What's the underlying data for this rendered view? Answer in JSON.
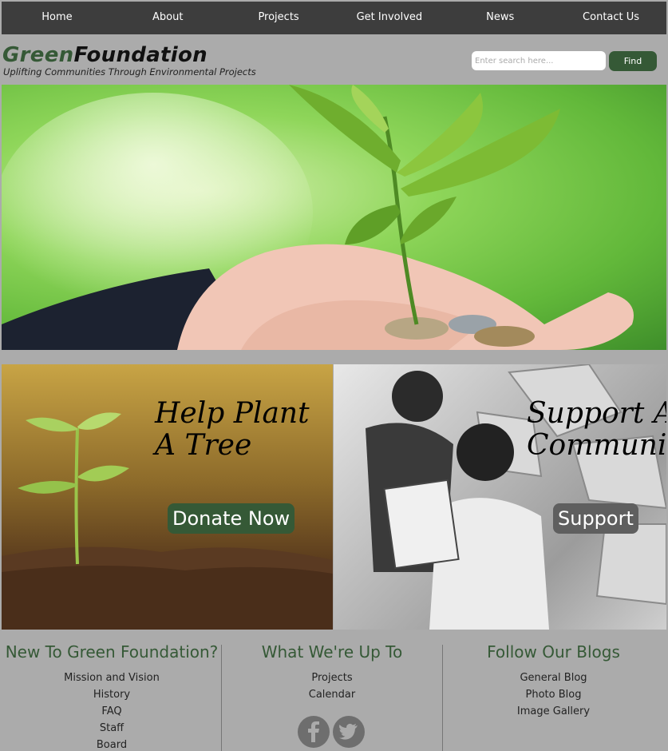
{
  "nav": [
    "Home",
    "About",
    "Projects",
    "Get Involved",
    "News",
    "Contact Us"
  ],
  "brand": {
    "logo_green": "Green",
    "logo_black": "Foundation",
    "tagline": "Uplifting Communities Through Environmental Projects"
  },
  "search": {
    "placeholder": "Enter search here...",
    "button": "Find"
  },
  "panels": [
    {
      "title_line1": "Help Plant",
      "title_line2": "A Tree",
      "button": "Donate Now"
    },
    {
      "title_line1": "Support A",
      "title_line2": "Community",
      "button": "Support"
    }
  ],
  "footer": [
    {
      "heading": "New To Green Foundation?",
      "links": [
        "Mission and Vision",
        "History",
        "FAQ",
        "Staff",
        "Board"
      ]
    },
    {
      "heading": "What We're Up To",
      "links": [
        "Projects",
        "Calendar"
      ]
    },
    {
      "heading": "Follow Our Blogs",
      "links": [
        "General Blog",
        "Photo Blog",
        "Image Gallery"
      ]
    }
  ],
  "colors": {
    "brand_green": "#355936",
    "nav_bg": "#3d3d3d",
    "page_bg": "#ababab",
    "support_btn": "#5f5f5f"
  },
  "icons": [
    "facebook-icon",
    "twitter-icon"
  ]
}
